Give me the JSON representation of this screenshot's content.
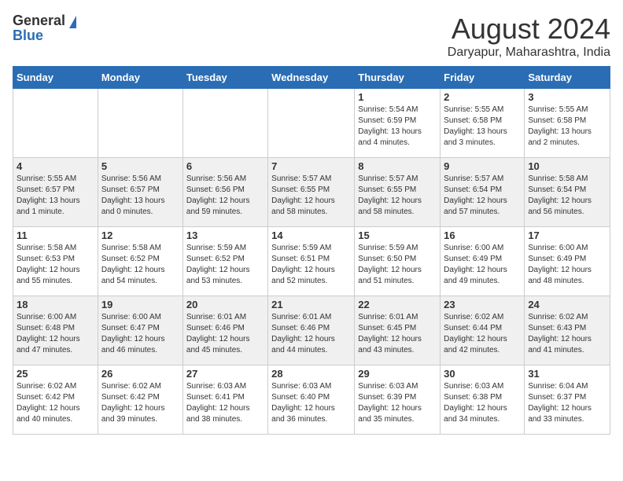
{
  "header": {
    "logo_general": "General",
    "logo_blue": "Blue",
    "title": "August 2024",
    "subtitle": "Daryapur, Maharashtra, India"
  },
  "days_of_week": [
    "Sunday",
    "Monday",
    "Tuesday",
    "Wednesday",
    "Thursday",
    "Friday",
    "Saturday"
  ],
  "weeks": [
    [
      {
        "day": "",
        "info": ""
      },
      {
        "day": "",
        "info": ""
      },
      {
        "day": "",
        "info": ""
      },
      {
        "day": "",
        "info": ""
      },
      {
        "day": "1",
        "info": "Sunrise: 5:54 AM\nSunset: 6:59 PM\nDaylight: 13 hours\nand 4 minutes."
      },
      {
        "day": "2",
        "info": "Sunrise: 5:55 AM\nSunset: 6:58 PM\nDaylight: 13 hours\nand 3 minutes."
      },
      {
        "day": "3",
        "info": "Sunrise: 5:55 AM\nSunset: 6:58 PM\nDaylight: 13 hours\nand 2 minutes."
      }
    ],
    [
      {
        "day": "4",
        "info": "Sunrise: 5:55 AM\nSunset: 6:57 PM\nDaylight: 13 hours\nand 1 minute."
      },
      {
        "day": "5",
        "info": "Sunrise: 5:56 AM\nSunset: 6:57 PM\nDaylight: 13 hours\nand 0 minutes."
      },
      {
        "day": "6",
        "info": "Sunrise: 5:56 AM\nSunset: 6:56 PM\nDaylight: 12 hours\nand 59 minutes."
      },
      {
        "day": "7",
        "info": "Sunrise: 5:57 AM\nSunset: 6:55 PM\nDaylight: 12 hours\nand 58 minutes."
      },
      {
        "day": "8",
        "info": "Sunrise: 5:57 AM\nSunset: 6:55 PM\nDaylight: 12 hours\nand 58 minutes."
      },
      {
        "day": "9",
        "info": "Sunrise: 5:57 AM\nSunset: 6:54 PM\nDaylight: 12 hours\nand 57 minutes."
      },
      {
        "day": "10",
        "info": "Sunrise: 5:58 AM\nSunset: 6:54 PM\nDaylight: 12 hours\nand 56 minutes."
      }
    ],
    [
      {
        "day": "11",
        "info": "Sunrise: 5:58 AM\nSunset: 6:53 PM\nDaylight: 12 hours\nand 55 minutes."
      },
      {
        "day": "12",
        "info": "Sunrise: 5:58 AM\nSunset: 6:52 PM\nDaylight: 12 hours\nand 54 minutes."
      },
      {
        "day": "13",
        "info": "Sunrise: 5:59 AM\nSunset: 6:52 PM\nDaylight: 12 hours\nand 53 minutes."
      },
      {
        "day": "14",
        "info": "Sunrise: 5:59 AM\nSunset: 6:51 PM\nDaylight: 12 hours\nand 52 minutes."
      },
      {
        "day": "15",
        "info": "Sunrise: 5:59 AM\nSunset: 6:50 PM\nDaylight: 12 hours\nand 51 minutes."
      },
      {
        "day": "16",
        "info": "Sunrise: 6:00 AM\nSunset: 6:49 PM\nDaylight: 12 hours\nand 49 minutes."
      },
      {
        "day": "17",
        "info": "Sunrise: 6:00 AM\nSunset: 6:49 PM\nDaylight: 12 hours\nand 48 minutes."
      }
    ],
    [
      {
        "day": "18",
        "info": "Sunrise: 6:00 AM\nSunset: 6:48 PM\nDaylight: 12 hours\nand 47 minutes."
      },
      {
        "day": "19",
        "info": "Sunrise: 6:00 AM\nSunset: 6:47 PM\nDaylight: 12 hours\nand 46 minutes."
      },
      {
        "day": "20",
        "info": "Sunrise: 6:01 AM\nSunset: 6:46 PM\nDaylight: 12 hours\nand 45 minutes."
      },
      {
        "day": "21",
        "info": "Sunrise: 6:01 AM\nSunset: 6:46 PM\nDaylight: 12 hours\nand 44 minutes."
      },
      {
        "day": "22",
        "info": "Sunrise: 6:01 AM\nSunset: 6:45 PM\nDaylight: 12 hours\nand 43 minutes."
      },
      {
        "day": "23",
        "info": "Sunrise: 6:02 AM\nSunset: 6:44 PM\nDaylight: 12 hours\nand 42 minutes."
      },
      {
        "day": "24",
        "info": "Sunrise: 6:02 AM\nSunset: 6:43 PM\nDaylight: 12 hours\nand 41 minutes."
      }
    ],
    [
      {
        "day": "25",
        "info": "Sunrise: 6:02 AM\nSunset: 6:42 PM\nDaylight: 12 hours\nand 40 minutes."
      },
      {
        "day": "26",
        "info": "Sunrise: 6:02 AM\nSunset: 6:42 PM\nDaylight: 12 hours\nand 39 minutes."
      },
      {
        "day": "27",
        "info": "Sunrise: 6:03 AM\nSunset: 6:41 PM\nDaylight: 12 hours\nand 38 minutes."
      },
      {
        "day": "28",
        "info": "Sunrise: 6:03 AM\nSunset: 6:40 PM\nDaylight: 12 hours\nand 36 minutes."
      },
      {
        "day": "29",
        "info": "Sunrise: 6:03 AM\nSunset: 6:39 PM\nDaylight: 12 hours\nand 35 minutes."
      },
      {
        "day": "30",
        "info": "Sunrise: 6:03 AM\nSunset: 6:38 PM\nDaylight: 12 hours\nand 34 minutes."
      },
      {
        "day": "31",
        "info": "Sunrise: 6:04 AM\nSunset: 6:37 PM\nDaylight: 12 hours\nand 33 minutes."
      }
    ]
  ]
}
